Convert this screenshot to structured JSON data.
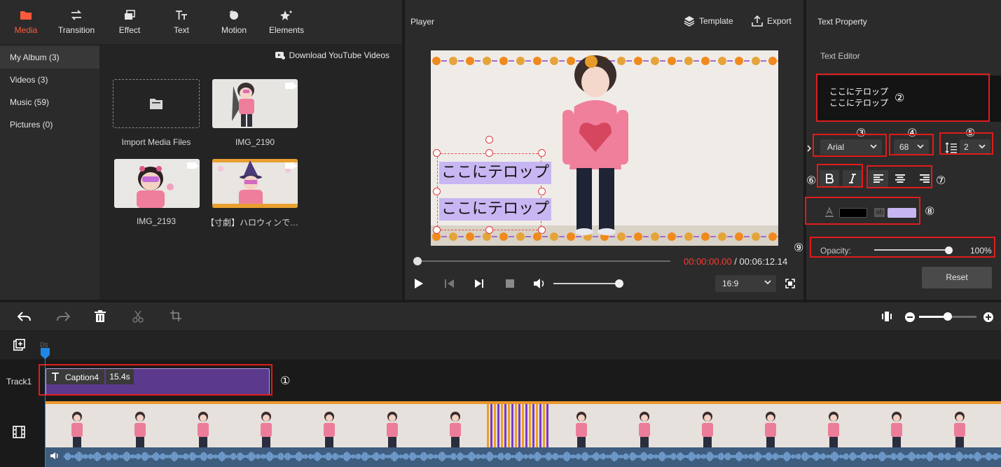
{
  "tabs": [
    {
      "label": "Media",
      "icon": "folder-icon",
      "active": true
    },
    {
      "label": "Transition",
      "icon": "swap-icon",
      "active": false
    },
    {
      "label": "Effect",
      "icon": "layers-icon",
      "active": false
    },
    {
      "label": "Text",
      "icon": "text-icon",
      "active": false
    },
    {
      "label": "Motion",
      "icon": "motion-icon",
      "active": false
    },
    {
      "label": "Elements",
      "icon": "sparkle-icon",
      "active": false
    }
  ],
  "album": {
    "items": [
      "My Album (3)",
      "Videos (3)",
      "Music (59)",
      "Pictures (0)"
    ],
    "download_link": "Download YouTube Videos"
  },
  "media": {
    "import_label": "Import Media Files",
    "files": [
      "IMG_2190",
      "IMG_2193",
      "【寸劇】ハロウィンでちー..."
    ]
  },
  "player": {
    "title": "Player",
    "template_label": "Template",
    "export_label": "Export",
    "caption_line1": "ここにテロップ",
    "caption_line2": "ここにテロップ",
    "time_current": "00:00:00.00",
    "time_separator": " / ",
    "time_total": "00:06:12.14",
    "aspect_ratio": "16:9",
    "progress": 0,
    "volume": 1.0
  },
  "text_property": {
    "title": "Text Property",
    "editor_label": "Text Editor",
    "editor_line1": "ここにテロップ",
    "editor_line2": "ここにテロップ",
    "font": "Arial",
    "size": "68",
    "line_spacing": "2",
    "text_color": "#000000",
    "bg_color": "#c7b6f2",
    "opacity_label": "Opacity:",
    "opacity_value": "100%",
    "opacity": 1.0,
    "reset_label": "Reset",
    "markers": [
      "②",
      "③",
      "④",
      "⑤",
      "⑥",
      "⑦",
      "⑧",
      "⑨"
    ]
  },
  "timeline": {
    "ruler_start": "0s",
    "track_label": "Track1",
    "clip_name": "Caption4",
    "clip_duration": "15.4s",
    "marker_1": "①",
    "zoom": 0.5
  },
  "colors": {
    "accent": "#ff5a3c",
    "highlight_box": "#e01c1c",
    "playhead": "#1e88e5",
    "clip_fill": "#5b3a8e"
  }
}
